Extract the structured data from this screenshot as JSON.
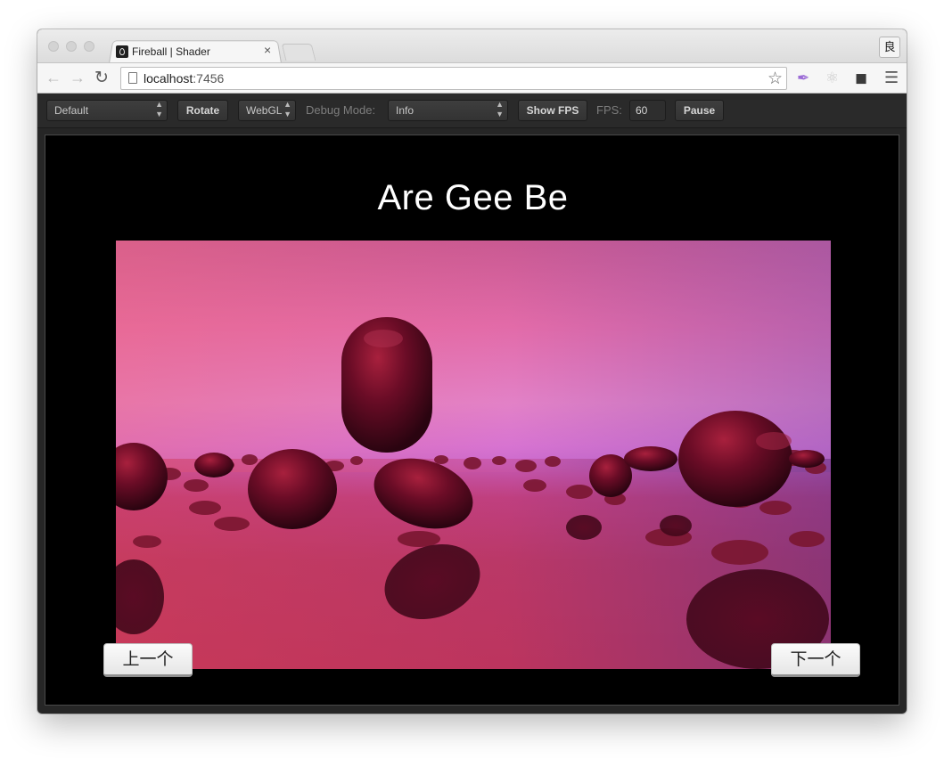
{
  "browser": {
    "tab_title": "Fireball | Shader",
    "tab_close": "×",
    "url_host": "localhost",
    "url_port": ":7456",
    "profile_glyph": "良"
  },
  "controls": {
    "preset_select": "Default",
    "rotate_label": "Rotate",
    "renderer_select": "WebGL",
    "debug_mode_label": "Debug Mode:",
    "debug_mode_select": "Info",
    "show_fps_label": "Show FPS",
    "fps_label": "FPS:",
    "fps_value": "60",
    "pause_label": "Pause"
  },
  "demo": {
    "title": "Are Gee Be",
    "prev_label": "上一个",
    "next_label": "下一个"
  },
  "icons": {
    "back": "back-arrow-icon",
    "forward": "forward-arrow-icon",
    "reload": "reload-icon",
    "page": "page-icon",
    "bookmark": "star-icon",
    "extension_1": "feather-icon",
    "extension_2": "react-icon",
    "extension_3": "evernote-icon",
    "menu": "hamburger-menu-icon"
  },
  "colors": {
    "stage_background": "#000000",
    "control_bar": "#2a2a2a",
    "sky_pink": "#e46aa3",
    "sky_violet": "#c86ad0",
    "floor_red": "#bb3557",
    "blob_dark": "#3a0616"
  }
}
